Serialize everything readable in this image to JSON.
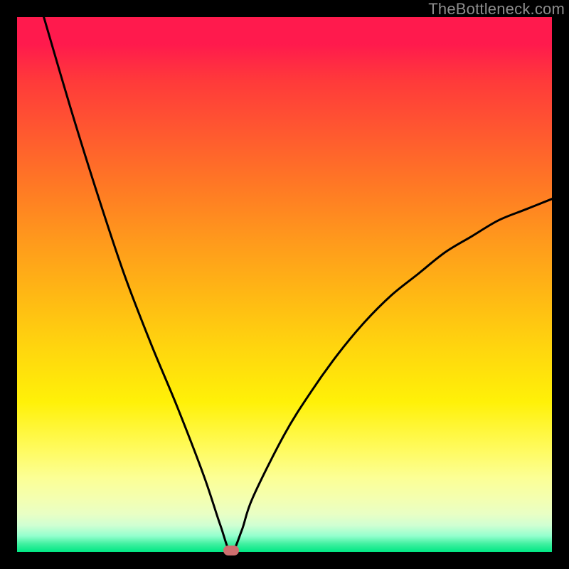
{
  "watermark": "TheBottleneck.com",
  "chart_data": {
    "type": "line",
    "title": "",
    "xlabel": "",
    "ylabel": "",
    "xlim": [
      0,
      100
    ],
    "ylim": [
      0,
      100
    ],
    "grid": false,
    "legend": false,
    "series": [
      {
        "name": "curve",
        "x": [
          5,
          10,
          15,
          20,
          25,
          30,
          35,
          38,
          40,
          42,
          44,
          50,
          55,
          60,
          65,
          70,
          75,
          80,
          85,
          90,
          95,
          100
        ],
        "y": [
          100,
          83,
          67,
          52,
          39,
          27,
          14,
          5,
          0,
          4,
          10,
          22,
          30,
          37,
          43,
          48,
          52,
          56,
          59,
          62,
          64,
          66
        ]
      }
    ],
    "marker": {
      "x": 40,
      "y": 0
    },
    "background_gradient": {
      "top": "#ff1a4d",
      "mid": "#ffe600",
      "bottom": "#00e884"
    }
  }
}
